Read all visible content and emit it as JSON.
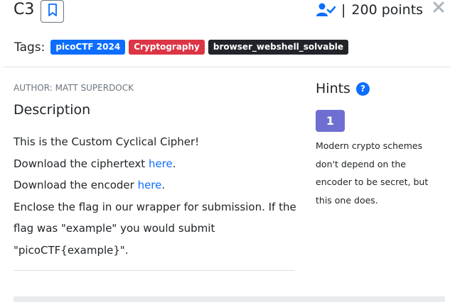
{
  "challenge": {
    "title": "C3",
    "points_separator": "|",
    "points": "200 points"
  },
  "tags": {
    "label": "Tags:",
    "items": [
      "picoCTF 2024",
      "Cryptography",
      "browser_webshell_solvable"
    ]
  },
  "author": "AUTHOR: MATT SUPERDOCK",
  "description": {
    "heading": "Description",
    "line1": "This is the Custom Cyclical Cipher!",
    "line2_prefix": "Download the ciphertext ",
    "line2_link": "here",
    "line2_suffix": ".",
    "line3_prefix": "Download the encoder ",
    "line3_link": "here",
    "line3_suffix": ".",
    "line4": "Enclose the flag in our wrapper for submission. If the flag was \"example\" you would submit \"picoCTF{example}\"."
  },
  "hints": {
    "heading": "Hints",
    "help_icon_glyph": "?",
    "buttons": [
      "1"
    ],
    "text": "Modern crypto schemes don't depend on the encoder to be secret, but this one does."
  },
  "colors": {
    "primary": "#0d6efd",
    "danger": "#dc3545",
    "dark": "#212529",
    "hint_button": "#6f6fd2",
    "close_icon": "#adb5bd"
  },
  "icons": {
    "bookmark": "bookmark-icon",
    "user_check": "user-check-icon",
    "close": "close-icon",
    "help": "question-circle-icon"
  }
}
